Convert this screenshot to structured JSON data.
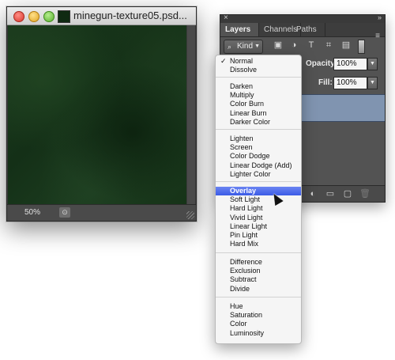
{
  "document": {
    "title": "minegun-texture05.psd...",
    "zoom": "50%",
    "status_icon": "preview-icon"
  },
  "panel": {
    "tabs": [
      "Layers",
      "Channels",
      "Paths"
    ],
    "active_tab": "Layers",
    "kind_label": "Kind",
    "opacity_label": "Opacity:",
    "opacity_value": "100%",
    "fill_label": "Fill:",
    "fill_value": "100%",
    "filter_icons": [
      "image-filter-icon",
      "adjustment-filter-icon",
      "type-filter-icon",
      "shape-filter-icon",
      "smart-object-filter-icon"
    ],
    "footer_icons": [
      "adjustment-layer-icon",
      "group-folder-icon",
      "new-layer-icon",
      "trash-icon"
    ],
    "selected_color": "#8094b0"
  },
  "blend_menu": {
    "groups": [
      [
        "Normal",
        "Dissolve"
      ],
      [
        "Darken",
        "Multiply",
        "Color Burn",
        "Linear Burn",
        "Darker Color"
      ],
      [
        "Lighten",
        "Screen",
        "Color Dodge",
        "Linear Dodge (Add)",
        "Lighter Color"
      ],
      [
        "Overlay",
        "Soft Light",
        "Hard Light",
        "Vivid Light",
        "Linear Light",
        "Pin Light",
        "Hard Mix"
      ],
      [
        "Difference",
        "Exclusion",
        "Subtract",
        "Divide"
      ],
      [
        "Hue",
        "Saturation",
        "Color",
        "Luminosity"
      ]
    ],
    "checked": "Normal",
    "highlighted": "Overlay",
    "highlight_color": "#3b5be6"
  }
}
